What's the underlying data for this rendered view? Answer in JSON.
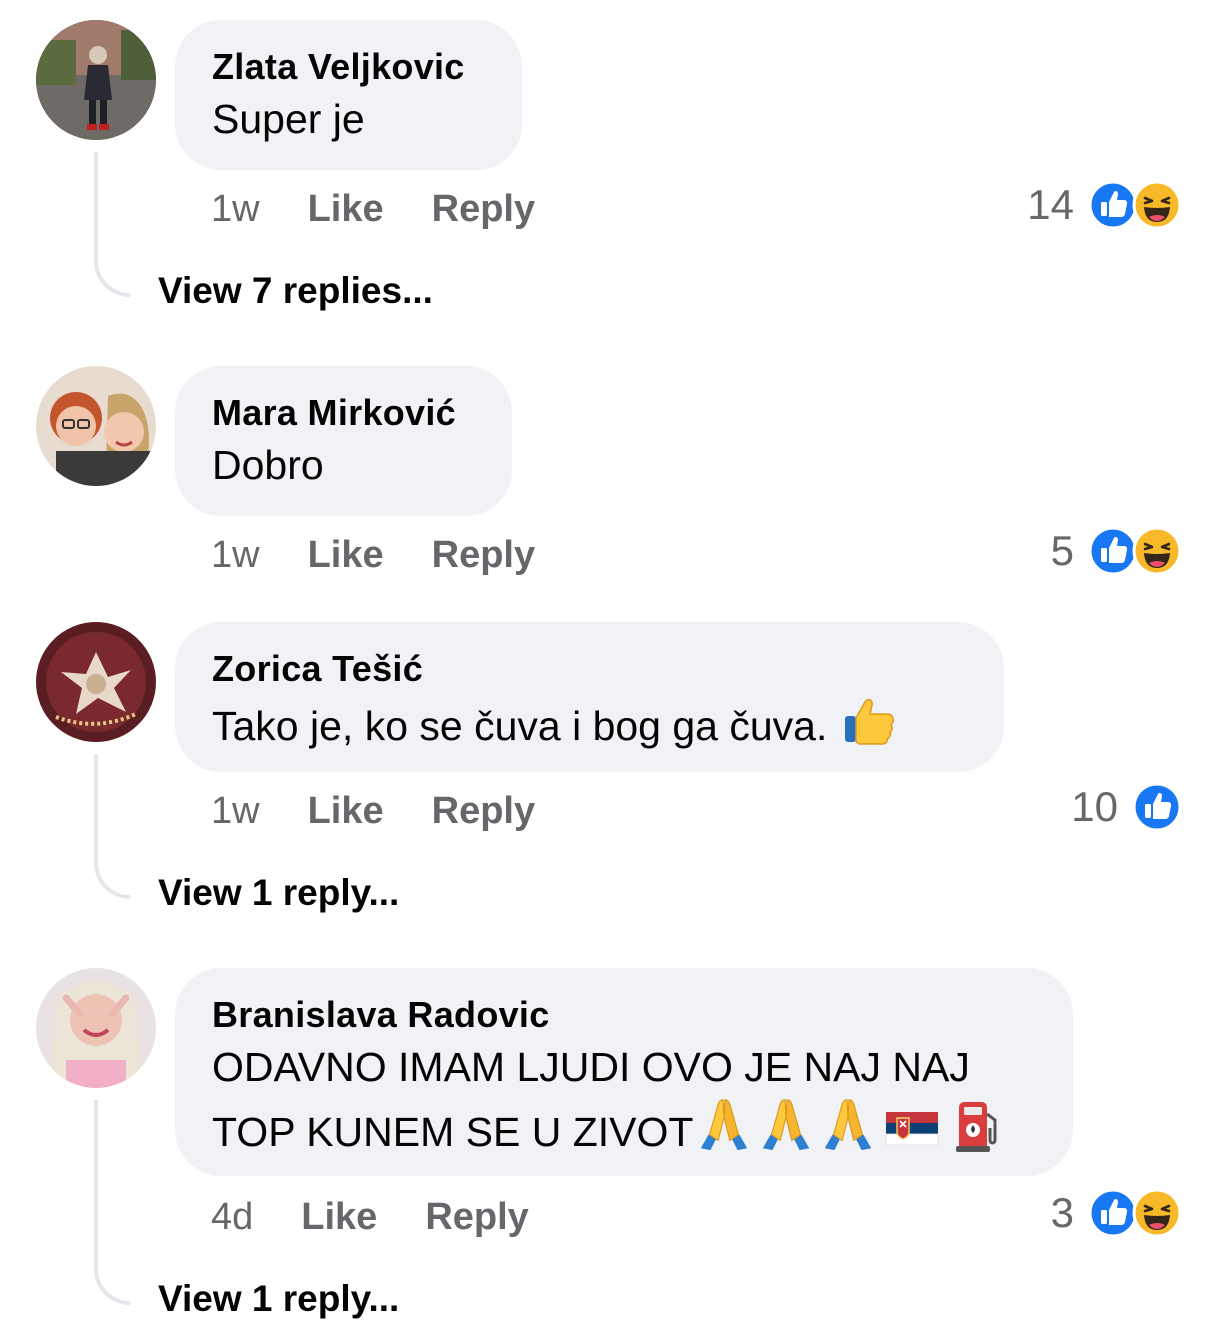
{
  "comments": [
    {
      "author": "Zlata Veljkovic",
      "text": "Super je",
      "time": "1w",
      "like_label": "Like",
      "reply_label": "Reply",
      "reaction_count": "14",
      "reactions": [
        "like-icon",
        "haha-icon"
      ],
      "view_replies": "View 7 replies..."
    },
    {
      "author": "Mara Mirković",
      "text": "Dobro",
      "time": "1w",
      "like_label": "Like",
      "reply_label": "Reply",
      "reaction_count": "5",
      "reactions": [
        "like-icon",
        "haha-icon"
      ]
    },
    {
      "author": "Zorica Tešić",
      "text": "Tako je, ko se čuva i bog ga čuva.",
      "text_emoji": [
        "thumbs-up-emoji"
      ],
      "time": "1w",
      "like_label": "Like",
      "reply_label": "Reply",
      "reaction_count": "10",
      "reactions": [
        "like-icon"
      ],
      "view_replies": "View 1 reply..."
    },
    {
      "author": "Branislava Radovic",
      "text_line1": "ODAVNO IMAM LJUDI OVO JE NAJ NAJ",
      "text_line2": "TOP KUNEM SE U ZIVOT",
      "text_emoji": [
        "folded-hands-emoji",
        "folded-hands-emoji",
        "folded-hands-emoji",
        "serbia-flag-emoji",
        "fuel-pump-emoji"
      ],
      "time": "4d",
      "like_label": "Like",
      "reply_label": "Reply",
      "reaction_count": "3",
      "reactions": [
        "like-icon",
        "haha-icon"
      ],
      "view_replies": "View 1 reply..."
    }
  ],
  "colors": {
    "bubble": "#f0f2f5",
    "meta_text": "#65676b",
    "like_blue": "#1877f2",
    "haha_yellow": "#f7b928",
    "thread_line": "#e4e6eb"
  }
}
